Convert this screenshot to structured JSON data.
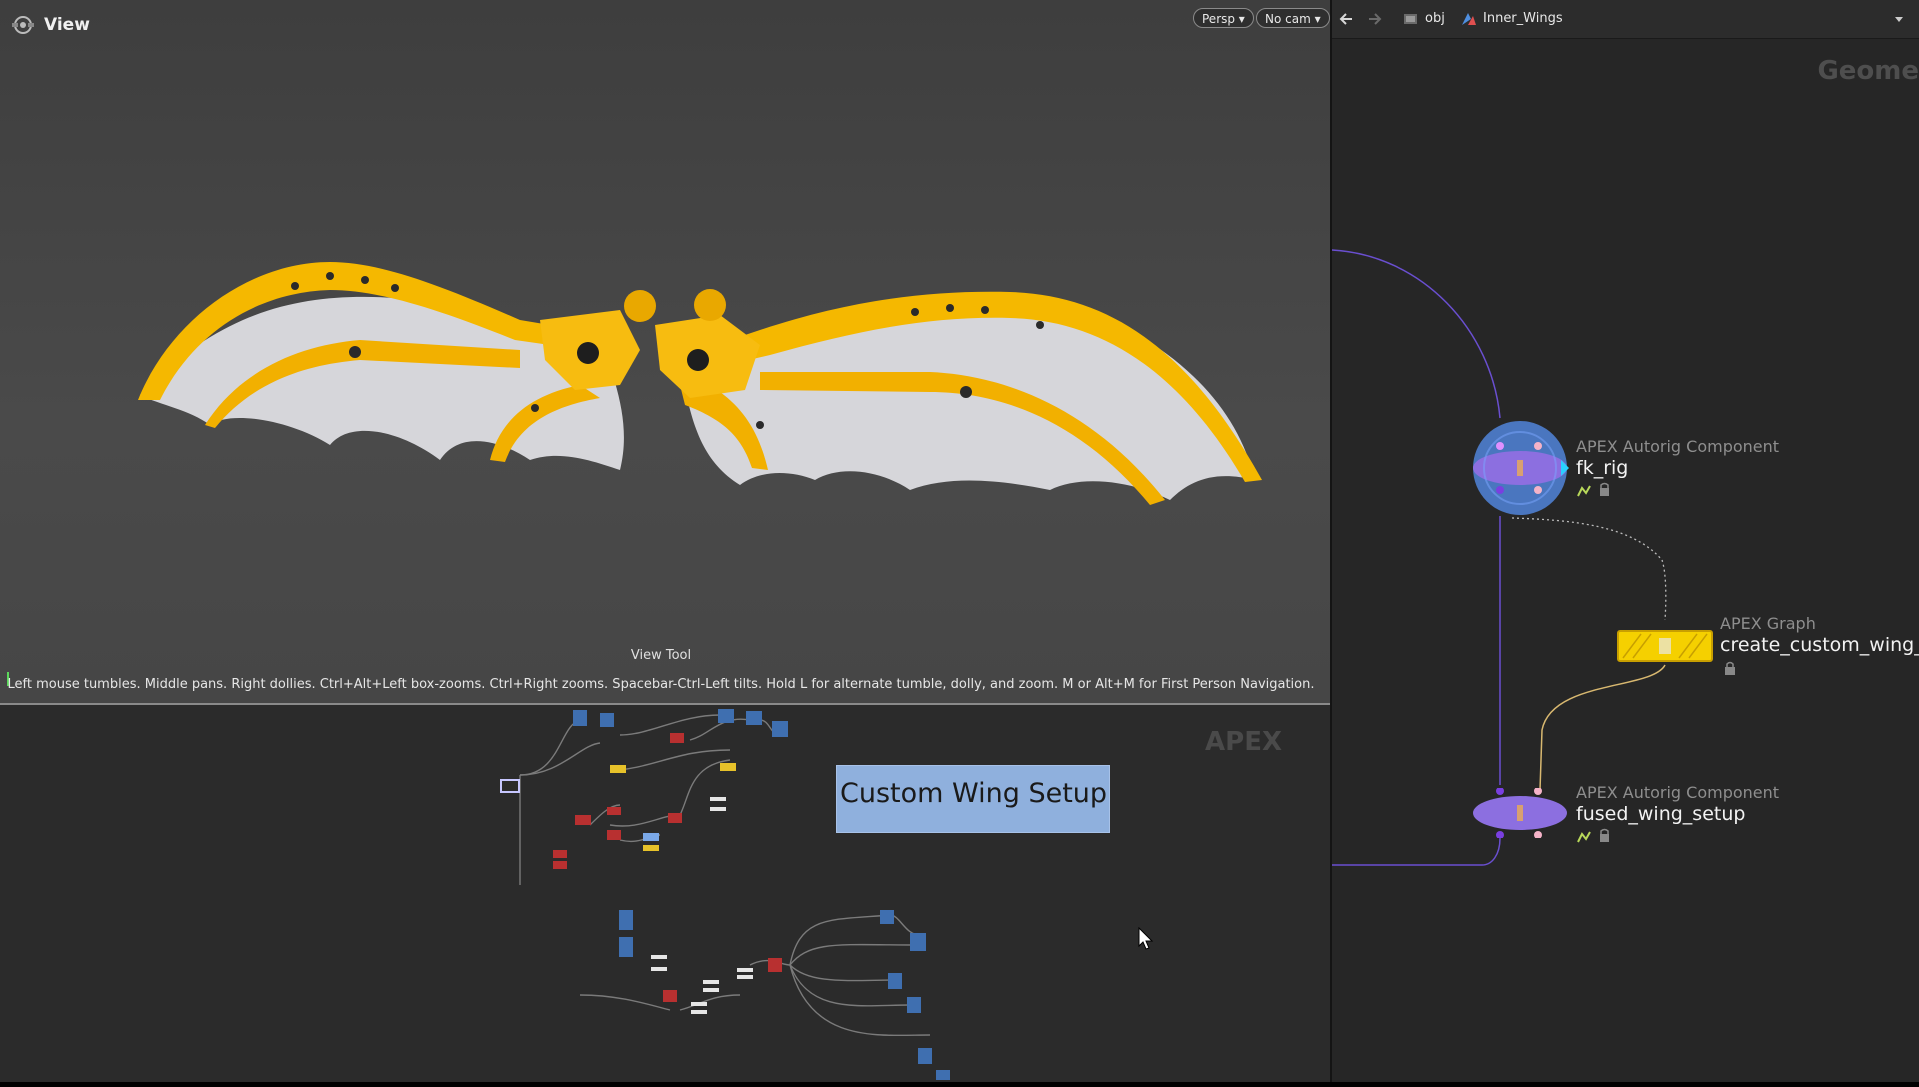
{
  "viewport": {
    "title": "View",
    "persp_button": "Persp ▾",
    "cam_button": "No cam ▾",
    "tool_name": "View Tool",
    "tool_help": "Left mouse tumbles. Middle pans. Right dollies. Ctrl+Alt+Left box-zooms. Ctrl+Right zooms. Spacebar-Ctrl-Left tilts. Hold L for alternate tumble, dolly, and zoom. M or Alt+M for First Person Navigation.",
    "axis_label": "y"
  },
  "apex_pane": {
    "watermark": "APEX",
    "sticky_note": "Custom Wing Setup"
  },
  "network": {
    "breadcrumb": [
      "obj",
      "Inner_Wings"
    ],
    "context_label": "Geome",
    "nodes": [
      {
        "type": "APEX Autorig Component",
        "name": "fk_rig"
      },
      {
        "type": "APEX Graph",
        "name": "create_custom_wing_r"
      },
      {
        "type": "APEX Autorig Component",
        "name": "fused_wing_setup"
      }
    ]
  },
  "colors": {
    "wing_gold": "#f5b800",
    "membrane": "#d8d8dc",
    "node_purple": "#8c6fe0",
    "node_selected_ring": "#4f7fd0",
    "graph_node_yellow": "#f5d000",
    "sticky_blue": "#8fb0dd"
  }
}
